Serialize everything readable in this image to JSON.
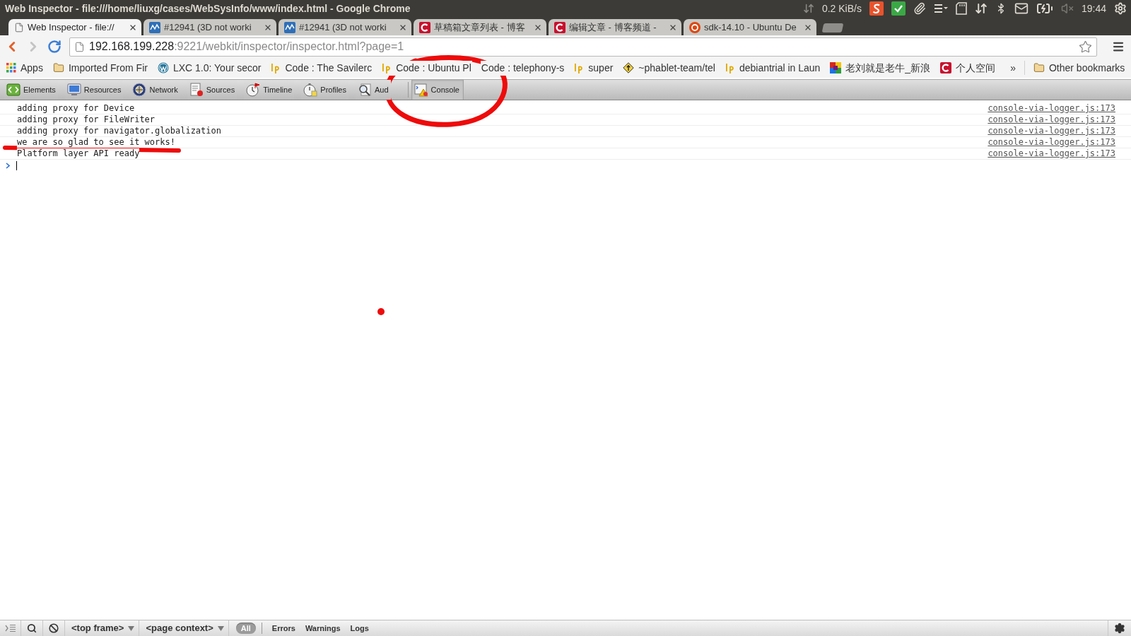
{
  "window": {
    "title": "Web Inspector - file:///home/liuxg/cases/WebSysInfo/www/index.html - Google Chrome"
  },
  "system_tray": {
    "network_speed": "0.2 KiB/s",
    "clock": "19:44"
  },
  "tabs": [
    {
      "title": "Web Inspector - file://",
      "kind": "page",
      "selected": true
    },
    {
      "title": "#12941 (3D not worki",
      "kind": "chart",
      "selected": false
    },
    {
      "title": "#12941 (3D not worki",
      "kind": "chart",
      "selected": false
    },
    {
      "title": "草稿箱文章列表 - 博客",
      "kind": "letter",
      "selected": false
    },
    {
      "title": "编辑文章 - 博客频道 -",
      "kind": "letter",
      "selected": false
    },
    {
      "title": "sdk-14.10 - Ubuntu De",
      "kind": "ring",
      "selected": false
    }
  ],
  "address_bar": {
    "host": "192.168.199.228",
    "path": ":9221/webkit/inspector/inspector.html?page=1"
  },
  "bookmarks": [
    {
      "label": "Apps",
      "kind": "apps"
    },
    {
      "label": "Imported From Fir",
      "kind": "folder"
    },
    {
      "label": "LXC 1.0: Your secor",
      "kind": "wlogo"
    },
    {
      "label": "Code : The Savilerc",
      "kind": "lp"
    },
    {
      "label": "Code : Ubuntu Pl",
      "kind": "lp"
    },
    {
      "label": "Code : telephony-s",
      "kind": "none"
    },
    {
      "label": "super",
      "kind": "lp"
    },
    {
      "label": "~phablet-team/tel",
      "kind": "diamond"
    },
    {
      "label": "debiantrial in Laun",
      "kind": "lp"
    },
    {
      "label": "老刘就是老牛_新浪",
      "kind": "mosaic"
    },
    {
      "label": "个人空间",
      "kind": "letter"
    }
  ],
  "bookmarks_overflow": "»",
  "other_bookmarks": "Other bookmarks",
  "devtools_toolbar": {
    "tabs": [
      {
        "label": "Elements",
        "kind": "elements",
        "selected": false
      },
      {
        "label": "Resources",
        "kind": "resources",
        "selected": false
      },
      {
        "label": "Network",
        "kind": "network",
        "selected": false
      },
      {
        "label": "Sources",
        "kind": "sources",
        "selected": false
      },
      {
        "label": "Timeline",
        "kind": "timeline",
        "selected": false
      },
      {
        "label": "Profiles",
        "kind": "profiles",
        "selected": false
      },
      {
        "label": "Aud",
        "kind": "audits",
        "selected": false
      },
      {
        "label": "Console",
        "kind": "console",
        "selected": true
      }
    ]
  },
  "console": {
    "messages": [
      {
        "text": "adding proxy for Device",
        "source": "console-via-logger.js:173"
      },
      {
        "text": "adding proxy for FileWriter",
        "source": "console-via-logger.js:173"
      },
      {
        "text": "adding proxy for navigator.globalization",
        "source": "console-via-logger.js:173"
      },
      {
        "text": "we are so glad to see it works!",
        "source": "console-via-logger.js:173"
      },
      {
        "text": "Platform layer API ready",
        "source": "console-via-logger.js:173"
      }
    ]
  },
  "status_bar": {
    "selects": [
      {
        "value": "<top frame>"
      },
      {
        "value": "<page context>"
      }
    ],
    "filters": [
      {
        "label": "All",
        "selected": true
      },
      {
        "label": "Errors",
        "selected": false
      },
      {
        "label": "Warnings",
        "selected": false
      },
      {
        "label": "Logs",
        "selected": false
      }
    ]
  }
}
